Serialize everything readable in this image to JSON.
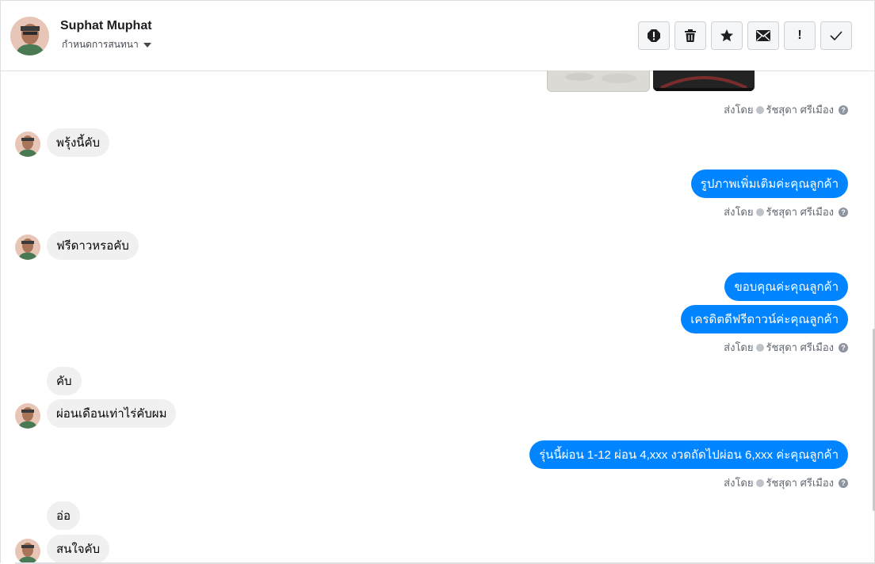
{
  "header": {
    "contact_name": "Suphat Muphat",
    "subtitle": "กำหนดการสนทนา",
    "toolbar": {
      "spam": "spam-icon",
      "delete": "trash-icon",
      "star": "star-icon",
      "unread": "mail-icon",
      "important_label": "!",
      "done": "check-icon"
    }
  },
  "sent_by": {
    "prefix": "ส่งโดย",
    "agent": "รัชสุดา ศรีเมือง",
    "help": "?"
  },
  "messages": {
    "m1": "พรุ้งนี้คับ",
    "m2": "รูปภาพเพิ่มเติมค่ะคุณลูกค้า",
    "m3": "ฟรีดาวหรอคับ",
    "m4": "ขอบคุณค่ะคุณลูกค้า",
    "m5": "เครดิตดีฟรีดาวน์ค่ะคุณลูกค้า",
    "m6": "คับ",
    "m7": "ผ่อนเดือนเท่าไร่คับผม",
    "m8": "รุ่นนี้ผ่อน 1-12 ผ่อน 4,xxx งวดถัดไปผ่อน 6,xxx ค่ะคุณลูกค้า",
    "m9": "อ่อ",
    "m10": "สนใจคับ"
  },
  "colors": {
    "outgoing": "#0084ff",
    "incoming": "#f0f0f0"
  }
}
